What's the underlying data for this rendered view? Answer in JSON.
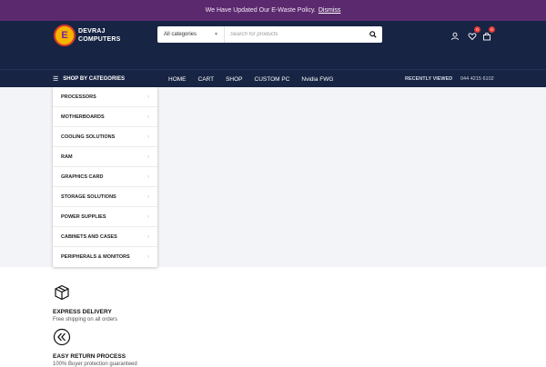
{
  "notice": {
    "text": "We Have Updated Our E-Waste Policy.",
    "link": "Dismiss"
  },
  "logo": {
    "mark": "E",
    "line1": "DEVRAJ",
    "line2": "COMPUTERS"
  },
  "search": {
    "category": "All categories",
    "placeholder": "Search for products"
  },
  "header_icons": {
    "wishlist_count": "0",
    "cart_count": "0"
  },
  "nav": {
    "categories_label": "SHOP BY CATEGORIES",
    "items": [
      "HOME",
      "CART",
      "SHOP",
      "CUSTOM PC",
      "Nvidia FWG"
    ],
    "recently_viewed": "RECENTLY VIEWED",
    "phone": "044 4215 6102"
  },
  "categories": [
    "PROCESSORS",
    "MOTHERBOARDS",
    "COOLING SOLUTIONS",
    "RAM",
    "GRAPHICS CARD",
    "STORAGE SOLUTIONS",
    "POWER SUPPLIES",
    "CABINETS AND CASES",
    "PERIPHERALS & MONITORS"
  ],
  "features": [
    {
      "title": "EXPRESS DELIVERY",
      "subtitle": "Free shipping on all orders"
    },
    {
      "title": "EASY RETURN PROCESS",
      "subtitle": "100% Buyer protection guaranteed"
    }
  ],
  "colors": {
    "notice_bg": "#5b2a6e",
    "header_bg": "#172443",
    "badge": "#e53935"
  }
}
